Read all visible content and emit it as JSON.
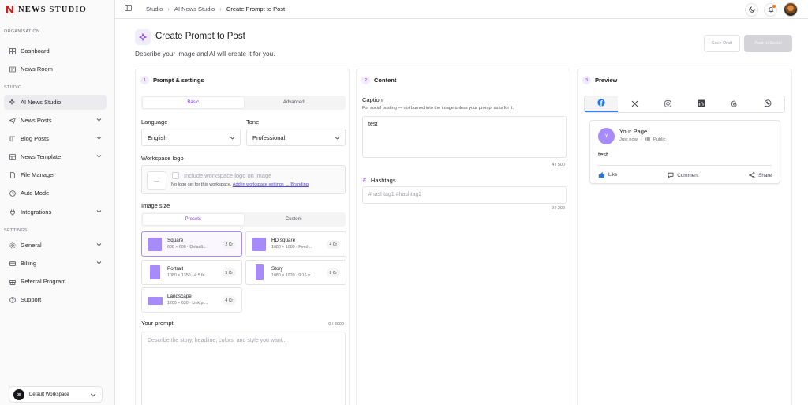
{
  "brand": {
    "name": "NEWS STUDIO",
    "accent": "#c81e1e"
  },
  "sidebar": {
    "section_org": "ORGANISATION",
    "section_studio": "STUDIO",
    "section_settings": "SETTINGS",
    "items": [
      {
        "label": "Dashboard",
        "icon": "grid-icon"
      },
      {
        "label": "News Room",
        "icon": "newspaper-icon"
      },
      {
        "label": "AI News Studio",
        "icon": "sparkle-icon",
        "active": true
      },
      {
        "label": "News Posts",
        "icon": "send-icon"
      },
      {
        "label": "Blog Posts",
        "icon": "book-icon"
      },
      {
        "label": "News Template",
        "icon": "template-icon"
      },
      {
        "label": "File Manager",
        "icon": "file-icon"
      },
      {
        "label": "Auto Mode",
        "icon": "clock-icon"
      },
      {
        "label": "Integrations",
        "icon": "plug-icon"
      },
      {
        "label": "General",
        "icon": "gear-icon"
      },
      {
        "label": "Billing",
        "icon": "card-icon"
      },
      {
        "label": "Referral Program",
        "icon": "gift-icon"
      },
      {
        "label": "Support",
        "icon": "help-icon"
      }
    ],
    "workspace": {
      "initials": "DE",
      "name": "Default Workspace"
    }
  },
  "breadcrumb": {
    "items": [
      "Studio",
      "AI News Studio"
    ],
    "current": "Create Prompt to Post"
  },
  "page": {
    "title": "Create Prompt to Post",
    "subtitle": "Describe your image and AI will create it for you.",
    "save_draft": "Save Draft",
    "post_social": "Post to Social"
  },
  "settings_panel": {
    "step": "1",
    "title": "Prompt & settings",
    "mode_tabs": [
      "Basic",
      "Advanced"
    ],
    "language_label": "Language",
    "language_value": "English",
    "tone_label": "Tone",
    "tone_value": "Professional",
    "logo_label": "Workspace logo",
    "logo_placeholder": "—",
    "logo_checkbox": "Include workspace logo on image",
    "logo_note": "No logo set for this workspace.",
    "logo_link": "Add in workspace settings → Branding",
    "size_label": "Image size",
    "size_tabs": [
      "Presets",
      "Custom"
    ],
    "presets": [
      {
        "name": "Square",
        "desc": "600 × 600 · Default...",
        "cost": "2 Cr"
      },
      {
        "name": "HD square",
        "desc": "1080 × 1080 · Feed ...",
        "cost": "4 Cr"
      },
      {
        "name": "Portrait",
        "desc": "1080 × 1350 · 4:5 fe...",
        "cost": "5 Cr"
      },
      {
        "name": "Story",
        "desc": "1080 × 1920 · 9:16 v...",
        "cost": "6 Cr"
      },
      {
        "name": "Landscape",
        "desc": "1200 × 630 · Link pr...",
        "cost": "4 Cr"
      }
    ],
    "prompt_label": "Your prompt",
    "prompt_counter": "0 / 3000",
    "prompt_placeholder": "Describe the story, headline, colors, and style you want..."
  },
  "content_panel": {
    "step": "2",
    "title": "Content",
    "caption_label": "Caption",
    "caption_note": "For social posting — not burned into the image unless your prompt asks for it.",
    "caption_value": "test",
    "caption_counter": "4 / 500",
    "hashtags_label": "Hashtags",
    "hashtags_placeholder": "#hashtag1 #hashtag2",
    "hashtags_counter": "0 / 200"
  },
  "preview_panel": {
    "step": "3",
    "title": "Preview",
    "platforms": [
      "facebook-icon",
      "x-icon",
      "instagram-icon",
      "linkedin-icon",
      "threads-icon",
      "whatsapp-icon"
    ],
    "post": {
      "avatar": "Y",
      "page_name": "Your Page",
      "time": "Just now",
      "dot": "·",
      "visibility": "Public",
      "text": "test",
      "like": "Like",
      "comment": "Comment",
      "share": "Share"
    }
  }
}
